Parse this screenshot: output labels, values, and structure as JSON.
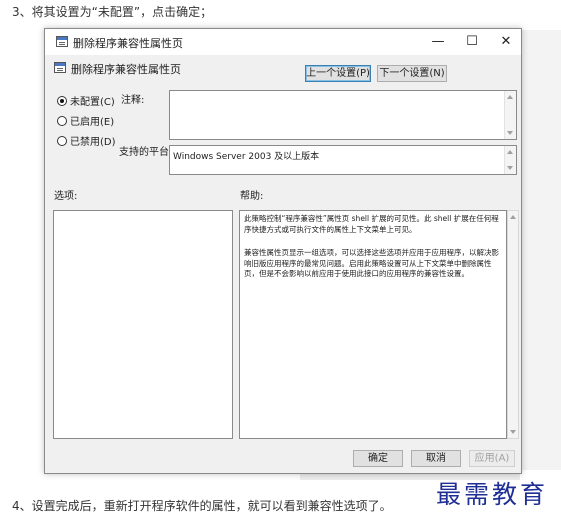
{
  "article": {
    "step3": "3、将其设置为“未配置”，点击确定；",
    "step4": "4、设置完成后，重新打开程序软件的属性，就可以看到兼容性选项了。"
  },
  "dialog": {
    "title": "删除程序兼容性属性页",
    "window_buttons": {
      "minimize": "—",
      "maximize": "☐",
      "close": "✕"
    },
    "header_title": "删除程序兼容性属性页",
    "prev_setting": "上一个设置(P)",
    "next_setting": "下一个设置(N)",
    "radios": [
      {
        "label": "未配置(C)",
        "checked": true
      },
      {
        "label": "已启用(E)",
        "checked": false
      },
      {
        "label": "已禁用(D)",
        "checked": false
      }
    ],
    "comment_label": "注释:",
    "comment_value": "",
    "supported_label": "支持的平台:",
    "supported_value": "Windows Server 2003 及以上版本",
    "options_label": "选项:",
    "help_label": "帮助:",
    "help_text_1": "此策略控制“程序兼容性”属性页 shell 扩展的可见性。此 shell 扩展在任何程序快捷方式或可执行文件的属性上下文菜单上可见。",
    "help_text_2": "兼容性属性页显示一组选项，可以选择这些选项并应用于应用程序，以解决影响旧版应用程序的最常见问题。启用此策略设置可从上下文菜单中删除属性页，但是不会影响以前应用于使用此接口的应用程序的兼容性设置。",
    "ok": "确定",
    "cancel": "取消",
    "apply": "应用(A)"
  },
  "watermark": "最需教育",
  "colors": {
    "accent_border": "#3c7fb1",
    "watermark": "#1f2f95",
    "dialog_bg": "#f0f0f0"
  },
  "icons": [
    "policy-icon",
    "minimize-icon",
    "maximize-icon",
    "close-icon"
  ]
}
